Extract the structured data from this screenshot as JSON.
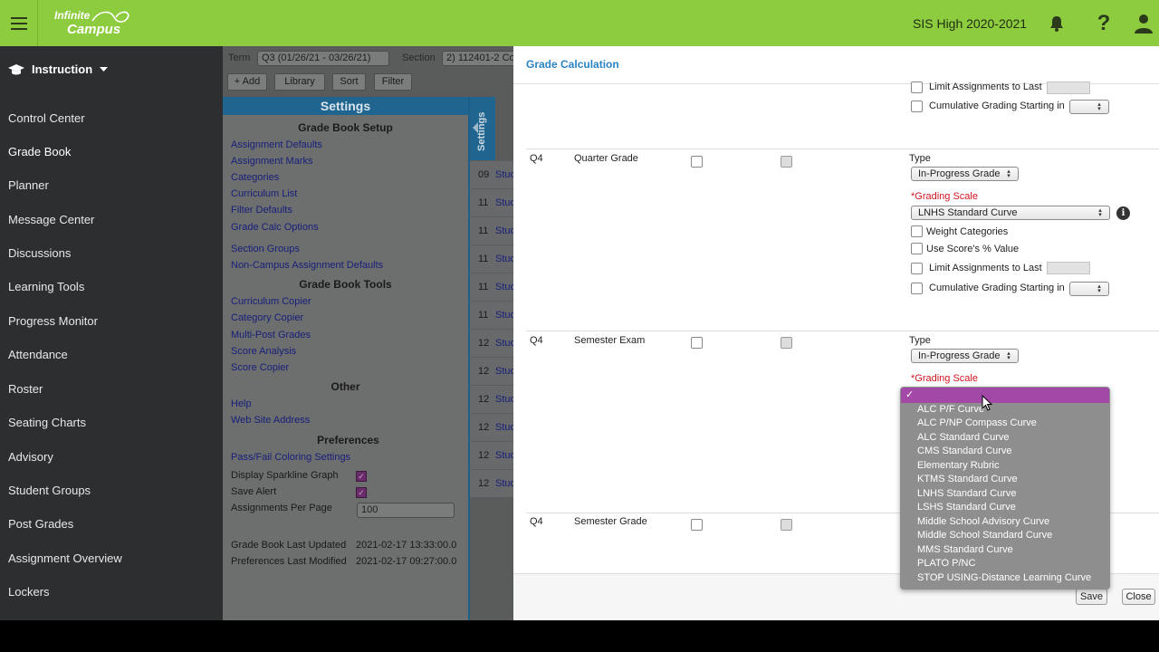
{
  "topbar": {
    "logo_line1": "Infinite",
    "logo_line2": "Campus",
    "school_year": "SIS High 2020-2021",
    "help_glyph": "?",
    "brand_color": "#8dcb3f"
  },
  "sidebar": {
    "header": "Instruction",
    "items": [
      "Control Center",
      "Grade Book",
      "Planner",
      "Message Center",
      "Discussions",
      "Learning Tools",
      "Progress Monitor",
      "Attendance",
      "Roster",
      "Seating Charts",
      "Advisory",
      "Student Groups",
      "Post Grades",
      "Assignment Overview",
      "Lockers"
    ]
  },
  "gradebook": {
    "term_label": "Term",
    "term_value": "Q3 (01/26/21 - 03/26/21)",
    "section_label": "Section",
    "section_value": "2) 112401-2 Co",
    "buttons": [
      "+ Add",
      "Library",
      "Sort",
      "Filter"
    ],
    "settings_title": "Settings",
    "settings_tab": "Settings",
    "setup_header": "Grade Book Setup",
    "setup_links": [
      "Assignment Defaults",
      "Assignment Marks",
      "Categories",
      "Curriculum List",
      "Filter Defaults",
      "Grade Calc Options",
      "Section Groups",
      "Non-Campus Assignment Defaults"
    ],
    "tools_header": "Grade Book Tools",
    "tools_links": [
      "Curriculum Copier",
      "Category Copier",
      "Multi-Post Grades",
      "Score Analysis",
      "Score Copier"
    ],
    "other_header": "Other",
    "other_links": [
      "Help",
      "Web Site Address"
    ],
    "prefs_header": "Preferences",
    "prefs_link": "Pass/Fail Coloring Settings",
    "pref_sparkline": "Display Sparkline Graph",
    "pref_save_alert": "Save Alert",
    "pref_per_page": "Assignments Per Page",
    "per_page_value": "100",
    "last_updated_label": "Grade Book Last Updated",
    "last_updated_value": "2021-02-17 13:33:00.0",
    "prefs_modified_label": "Preferences Last Modified",
    "prefs_modified_value": "2021-02-17 09:27:00.0",
    "checkmark": "✓",
    "student_rows": [
      {
        "grade": "09",
        "text": "Stud"
      },
      {
        "grade": "11",
        "text": "Stud"
      },
      {
        "grade": "11",
        "text": "Stud"
      },
      {
        "grade": "11",
        "text": "Stud"
      },
      {
        "grade": "11",
        "text": "Stud"
      },
      {
        "grade": "11",
        "text": "Stud"
      },
      {
        "grade": "12",
        "text": "Stud"
      },
      {
        "grade": "12",
        "text": "Stud"
      },
      {
        "grade": "12",
        "text": "Stud"
      },
      {
        "grade": "12",
        "text": "Stud"
      },
      {
        "grade": "12",
        "text": "Stud"
      },
      {
        "grade": "12",
        "text": "Stud"
      }
    ]
  },
  "modal": {
    "title": "Grade Calculation",
    "limit_label": "Limit Assignments to Last",
    "cumulative_label": "Cumulative Grading Starting in",
    "type_label": "Type",
    "scale_label": "*Grading Scale",
    "weight_label": "Weight Categories",
    "use_score_label": "Use Score's % Value",
    "rows": [
      {
        "term": "Q4",
        "name": "Quarter Grade",
        "type": "In-Progress Grade",
        "scale": "LNHS Standard Curve"
      },
      {
        "term": "Q4",
        "name": "Semester Exam",
        "type": "In-Progress Grade"
      },
      {
        "term": "Q4",
        "name": "Semester Grade"
      }
    ],
    "save_label": "Save",
    "close_label": "Close",
    "info_glyph": "i"
  },
  "dropdown": {
    "selected_mark": "✓",
    "accent": "#a249a8",
    "options": [
      "ALC P/F Curve",
      "ALC P/NP Compass Curve",
      "ALC Standard Curve",
      "CMS Standard Curve",
      "Elementary Rubric",
      "KTMS Standard Curve",
      "LNHS Standard Curve",
      "LSHS Standard Curve",
      "Middle School Advisory Curve",
      "Middle School Standard Curve",
      "MMS Standard Curve",
      "PLATO P/NC",
      "STOP USING-Distance Learning Curve"
    ]
  }
}
